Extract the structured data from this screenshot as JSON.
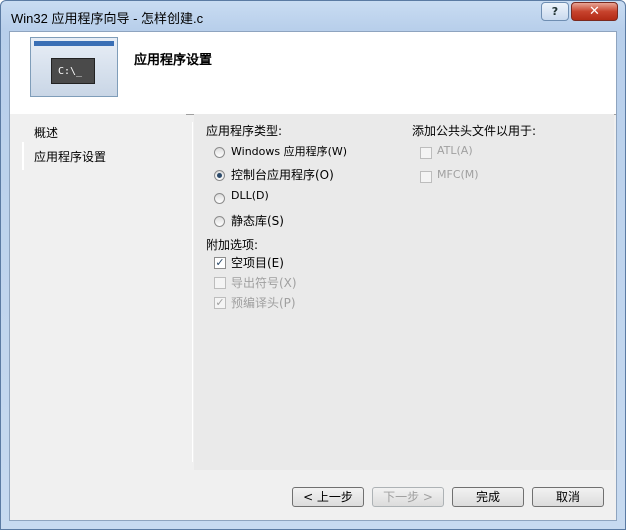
{
  "window": {
    "title": "Win32 应用程序向导 - 怎样创建.c",
    "help": "?",
    "close": "✕"
  },
  "header": {
    "title": "应用程序设置",
    "banner_text": "C:\\_"
  },
  "nav": {
    "items": [
      "概述",
      "应用程序设置"
    ]
  },
  "app_type": {
    "label": "应用程序类型:",
    "options": [
      "Windows 应用程序(W)",
      "控制台应用程序(O)",
      "DLL(D)",
      "静态库(S)"
    ],
    "selected": "控制台应用程序(O)"
  },
  "additional": {
    "label": "附加选项:",
    "options": [
      {
        "label": "空项目(E)",
        "checked": true,
        "enabled": true
      },
      {
        "label": "导出符号(X)",
        "checked": false,
        "enabled": false
      },
      {
        "label": "预编译头(P)",
        "checked": true,
        "enabled": false
      }
    ]
  },
  "common_headers": {
    "label": "添加公共头文件以用于:",
    "options": [
      {
        "label": "ATL(A)",
        "checked": false,
        "enabled": false
      },
      {
        "label": "MFC(M)",
        "checked": false,
        "enabled": false
      }
    ]
  },
  "buttons": {
    "prev": "< 上一步",
    "next": "下一步 >",
    "finish": "完成",
    "cancel": "取消"
  }
}
